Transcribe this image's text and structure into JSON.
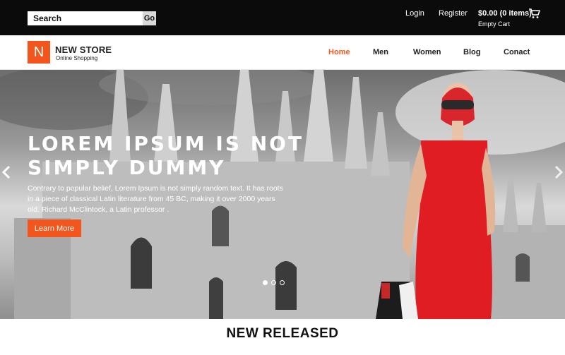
{
  "header": {
    "search_placeholder": "Search",
    "search_button": "Go",
    "login": "Login",
    "register": "Register",
    "cart_summary": "$0.00 (0 items)",
    "cart_status": "Empty Cart",
    "icons": [
      "cart-icon"
    ]
  },
  "brand": {
    "logo_letter": "N",
    "name": "NEW STORE",
    "tagline": "Online Shopping",
    "accent_color": "#f2561d"
  },
  "nav": {
    "items": [
      {
        "label": "Home",
        "active": true
      },
      {
        "label": "Men",
        "active": false
      },
      {
        "label": "Women",
        "active": false
      },
      {
        "label": "Blog",
        "active": false
      },
      {
        "label": "Conact",
        "active": false
      }
    ]
  },
  "hero": {
    "title": "LOREM IPSUM IS NOT SIMPLY DUMMY",
    "text": "Contrary to popular belief, Lorem Ipsum is not simply random text. It has roots in a piece of classical Latin literature from 45 BC, making it over 2000 years old. Richard McClintock, a Latin professor .",
    "button": "Learn More",
    "slides_total": 3,
    "slide_active": 1
  },
  "sections": {
    "new_released": "NEW RELEASED"
  }
}
